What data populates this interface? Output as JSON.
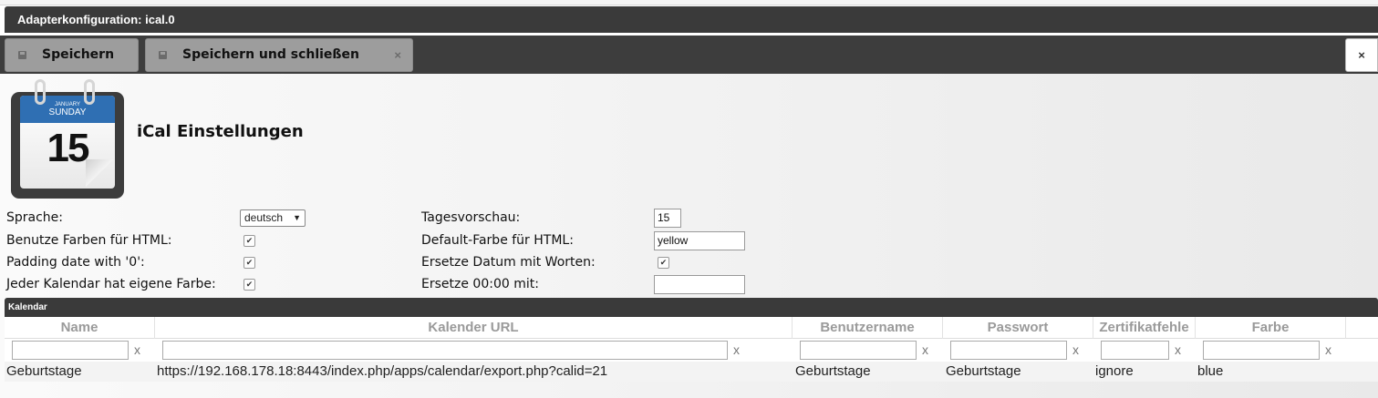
{
  "window": {
    "title": "Adapterkonfiguration: ical.0"
  },
  "toolbar": {
    "save_label": "Speichern",
    "save_close_label": "Speichern und schließen",
    "save_close_x": "×",
    "close_label": "×"
  },
  "page": {
    "title": "iCal Einstellungen"
  },
  "calendar_icon": {
    "month": "JANUARY",
    "weekday": "SUNDAY",
    "day": "15"
  },
  "settings": {
    "sprache_label": "Sprache:",
    "sprache_value": "deutsch",
    "farben_label": "Benutze Farben für HTML:",
    "padding_label": "Padding date with '0':",
    "eigene_farbe_label": "Jeder Kalendar hat eigene Farbe:",
    "tagesvorschau_label": "Tagesvorschau:",
    "tagesvorschau_value": "15",
    "default_farbe_label": "Default-Farbe für HTML:",
    "default_farbe_value": "yellow",
    "ersetze_datum_label": "Ersetze Datum mit Worten:",
    "ersetze_0000_label": "Ersetze 00:00 mit:",
    "ersetze_0000_value": ""
  },
  "table": {
    "section_title": "Kalendar",
    "columns": [
      "Name",
      "Kalender URL",
      "Benutzername",
      "Passwort",
      "Zertifikatfehle",
      "Farbe"
    ],
    "filter_clear": "x",
    "rows": [
      [
        "Geburtstage",
        "https://192.168.178.18:8443/index.php/apps/calendar/export.php?calid=21",
        "Geburtstage",
        "Geburtstage",
        "ignore",
        "blue"
      ]
    ]
  }
}
